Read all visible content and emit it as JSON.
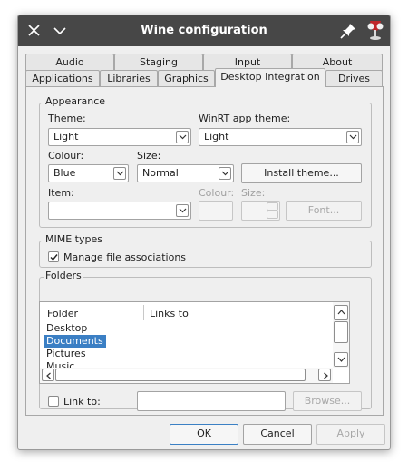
{
  "window": {
    "title": "Wine configuration",
    "icons": [
      "close-icon",
      "chevron-down-icon",
      "pin-icon",
      "wine-glass-app-icon"
    ]
  },
  "tabs": {
    "row1": [
      "Audio",
      "Staging",
      "Input",
      "About"
    ],
    "row2": [
      "Applications",
      "Libraries",
      "Graphics",
      "Desktop Integration",
      "Drives"
    ],
    "active": "Desktop Integration"
  },
  "appearance": {
    "group_title": "Appearance",
    "theme_label": "Theme:",
    "theme_value": "Light",
    "winrt_label": "WinRT app theme:",
    "winrt_value": "Light",
    "colour_label": "Colour:",
    "colour_value": "Blue",
    "size_label": "Size:",
    "size_value": "Normal",
    "install_theme_button": "Install theme...",
    "item_label": "Item:",
    "item_value": "",
    "item_colour_label": "Colour:",
    "item_size_label": "Size:",
    "font_button": "Font..."
  },
  "mime": {
    "group_title": "MIME types",
    "manage_label": "Manage file associations",
    "manage_checked": true
  },
  "folders": {
    "group_title": "Folders",
    "columns": [
      "Folder",
      "Links to"
    ],
    "rows": [
      "Desktop",
      "Documents",
      "Pictures",
      "Music"
    ],
    "selected": "Documents",
    "link_to_label": "Link to:",
    "link_to_checked": false,
    "link_to_value": "",
    "browse_button": "Browse..."
  },
  "footer": {
    "ok": "OK",
    "cancel": "Cancel",
    "apply": "Apply"
  },
  "colors": {
    "titlebar": "#474747",
    "selection": "#3b7fc4",
    "window_bg": "#efefef"
  }
}
